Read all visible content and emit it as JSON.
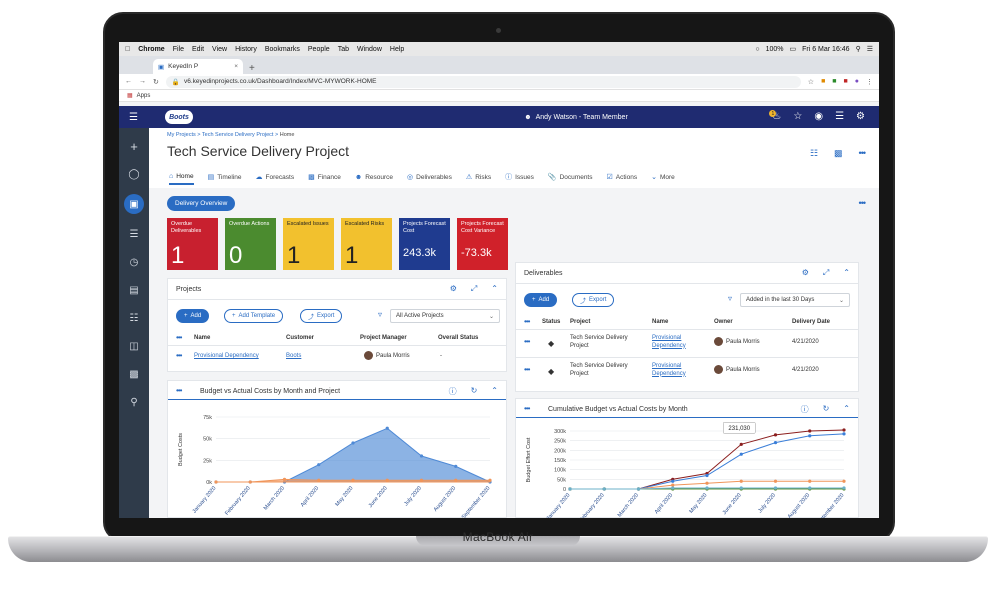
{
  "device": {
    "label": "MacBook Air"
  },
  "macbar": {
    "items": [
      "Chrome",
      "File",
      "Edit",
      "View",
      "History",
      "Bookmarks",
      "People",
      "Tab",
      "Window",
      "Help"
    ],
    "battery": "100%",
    "clock": "Fri 6 Mar 16:46"
  },
  "browser": {
    "tab_title": "KeyedIn P",
    "url": "v6.keyedinprojects.co.uk/Dashboard/Index/MVC-MYWORK-HOME",
    "apps": "Apps"
  },
  "topnav": {
    "logo": "Boots",
    "user": "Andy Watson - Team Member",
    "notifications": "1"
  },
  "header": {
    "crumb1": "My Projects",
    "crumb2": "Tech Service Delivery Project",
    "crumb3": "Home",
    "title": "Tech Service Delivery Project"
  },
  "tabs": [
    "Home",
    "Timeline",
    "Forecasts",
    "Finance",
    "Resource",
    "Deliverables",
    "Risks",
    "Issues",
    "Documents",
    "Actions",
    "More"
  ],
  "overview_button": "Delivery Overview",
  "tiles": [
    {
      "label": "Overdue Deliverables",
      "value": "1",
      "color": "#c8202f"
    },
    {
      "label": "Overdue Actions",
      "value": "0",
      "color": "#4b8b2f"
    },
    {
      "label": "Escalated Issues",
      "value": "1",
      "color": "#f2c12e"
    },
    {
      "label": "Escalated Risks",
      "value": "1",
      "color": "#f2c12e"
    },
    {
      "label": "Projects Forecast Cost",
      "value": "243.3k",
      "color": "#1f3b8f"
    },
    {
      "label": "Projects Forecast Cost Variance",
      "value": "-73.3k",
      "color": "#d0212a"
    }
  ],
  "projects": {
    "title": "Projects",
    "add": "Add",
    "add_template": "Add Template",
    "export": "Export",
    "filter": "All Active Projects",
    "columns": [
      "Name",
      "Customer",
      "Project Manager",
      "Overall Status"
    ],
    "rows": [
      {
        "name": "Provisional Dependency",
        "customer": "Boots",
        "manager": "Paula Morris",
        "status": "-"
      }
    ]
  },
  "deliverables": {
    "title": "Deliverables",
    "add": "Add",
    "export": "Export",
    "filter": "Added in the last 30 Days",
    "columns": [
      "Status",
      "Project",
      "Name",
      "Owner",
      "Delivery Date"
    ],
    "rows": [
      {
        "project": "Tech Service Delivery Project",
        "name": "Provisional Dependency",
        "owner": "Paula Morris",
        "date": "4/21/2020"
      },
      {
        "project": "Tech Service Delivery Project",
        "name": "Provisional Dependency",
        "owner": "Paula Morris",
        "date": "4/21/2020"
      }
    ]
  },
  "chart_data": [
    {
      "type": "area",
      "title": "Budget vs Actual Costs by Month and Project",
      "ylabel": "Budget Costs",
      "xlabel": "",
      "ylim": [
        0,
        75000
      ],
      "yticks": [
        "0k",
        "25k",
        "50k",
        "75k"
      ],
      "categories": [
        "January 2020",
        "February 2020",
        "March 2020",
        "April 2020",
        "May 2020",
        "June 2020",
        "July 2020",
        "August 2020",
        "September 2020"
      ],
      "series": [
        {
          "color": "#4f8ad6",
          "values": [
            0,
            0,
            0,
            20000,
            45000,
            62000,
            30000,
            18000,
            0
          ]
        },
        {
          "color": "#f0955a",
          "values": [
            0,
            0,
            3000,
            2000,
            2000,
            2000,
            2000,
            2000,
            2000
          ]
        }
      ]
    },
    {
      "type": "line",
      "title": "Cumulative Budget vs Actual Costs by Month",
      "ylabel": "Budget Effort Cost",
      "xlabel": "",
      "ylim": [
        0,
        300000
      ],
      "yticks": [
        "0",
        "50k",
        "100k",
        "150k",
        "200k",
        "250k",
        "300k"
      ],
      "annotation": "231,030",
      "categories": [
        "January 2020",
        "February 2020",
        "March 2020",
        "April 2020",
        "May 2020",
        "June 2020",
        "July 2020",
        "August 2020",
        "September 2020"
      ],
      "series": [
        {
          "color": "#8b1e1e",
          "values": [
            0,
            0,
            0,
            50000,
            80000,
            231030,
            280000,
            300000,
            305000
          ]
        },
        {
          "color": "#3a7ed8",
          "values": [
            0,
            0,
            0,
            40000,
            70000,
            180000,
            240000,
            275000,
            285000
          ]
        },
        {
          "color": "#f0955a",
          "values": [
            0,
            0,
            0,
            20000,
            30000,
            40000,
            40000,
            40000,
            40000
          ]
        },
        {
          "color": "#5a8f3a",
          "values": [
            0,
            0,
            0,
            0,
            0,
            0,
            0,
            0,
            0
          ]
        },
        {
          "color": "#6bb0c9",
          "values": [
            0,
            0,
            0,
            5000,
            5000,
            5000,
            5000,
            5000,
            5000
          ]
        }
      ]
    }
  ]
}
